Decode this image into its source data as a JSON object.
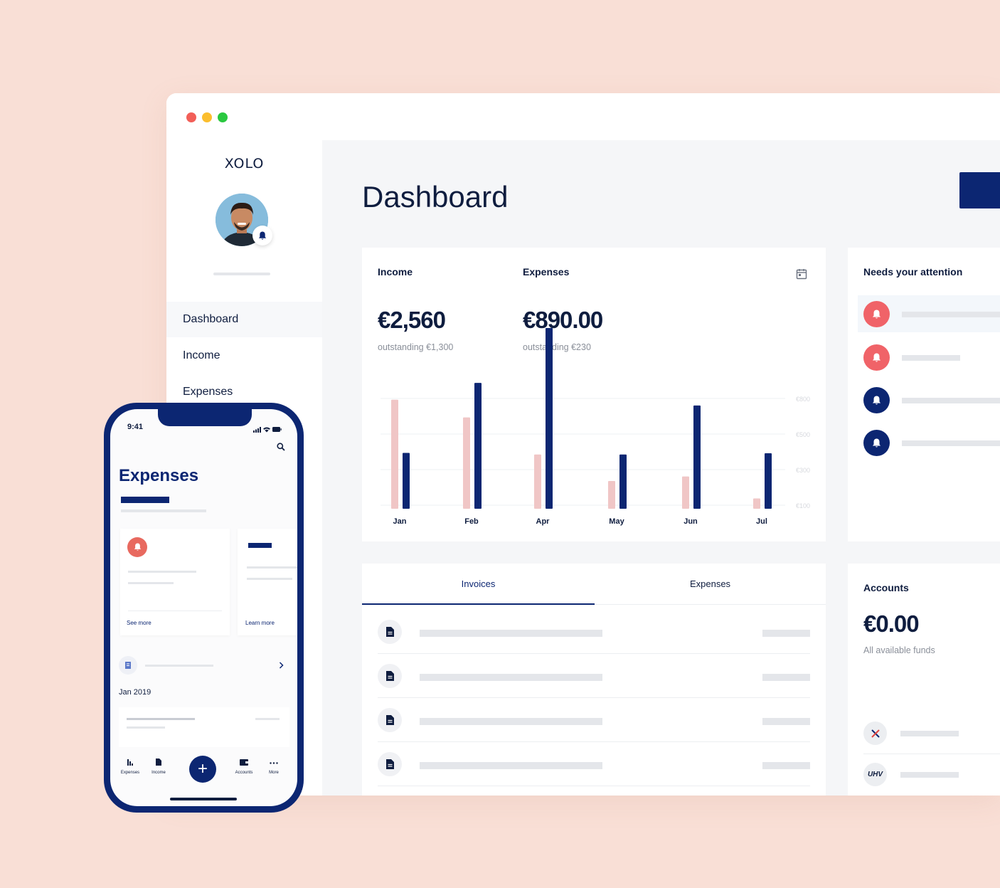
{
  "app": {
    "logo": "XOLO",
    "brand_color": "#0c2672",
    "alert_color": "#f06368",
    "bg_color": "#f9dfd6"
  },
  "sidebar": {
    "items": [
      {
        "label": "Dashboard",
        "active": true
      },
      {
        "label": "Income",
        "active": false
      },
      {
        "label": "Expenses",
        "active": false
      }
    ]
  },
  "main": {
    "title": "Dashboard"
  },
  "summary": {
    "income_label": "Income",
    "income_value": "€2,560",
    "income_note": "outstanding €1,300",
    "expenses_label": "Expenses",
    "expenses_value": "€890.00",
    "expenses_note": "outstanding €230",
    "calendar_icon": "calendar-icon"
  },
  "chart_data": {
    "type": "bar",
    "categories": [
      "Jan",
      "Feb",
      "Apr",
      "May",
      "Jun",
      "Jul"
    ],
    "series": [
      {
        "color": "#f0c6c6",
        "values": [
          338,
          283,
          168,
          86,
          100,
          32
        ]
      },
      {
        "color": "#0c2672",
        "values": [
          173,
          390,
          560,
          168,
          320,
          172
        ]
      }
    ],
    "yticks": [
      "€800",
      "€500",
      "€300",
      "€100"
    ],
    "grid": true
  },
  "attention": {
    "title": "Needs your attention",
    "items": [
      {
        "color": "#f06368",
        "highlighted": true
      },
      {
        "color": "#f06368",
        "highlighted": false
      },
      {
        "color": "#0c2672",
        "highlighted": false
      },
      {
        "color": "#0c2672",
        "highlighted": false
      }
    ]
  },
  "tabs": {
    "items": [
      "Invoices",
      "Expenses"
    ],
    "rows": 4
  },
  "accounts": {
    "title": "Accounts",
    "value": "€0.00",
    "note": "All available funds",
    "bank2_logo": "UHV"
  },
  "phone": {
    "time": "9:41",
    "title": "Expenses",
    "see_more": "See more",
    "learn_more": "Learn more",
    "date": "Jan 2019",
    "nav": [
      "Expenses",
      "Income",
      "Accounts",
      "More"
    ],
    "add_symbol": "+"
  }
}
